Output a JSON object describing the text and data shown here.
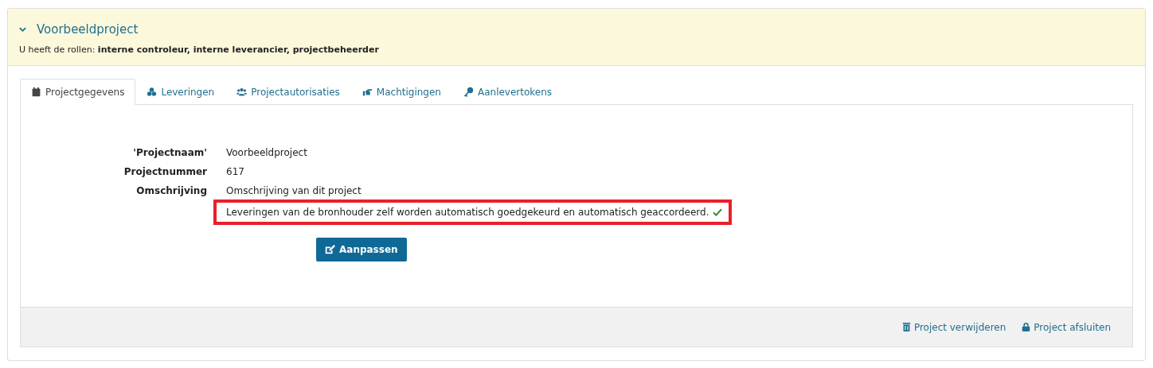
{
  "project": {
    "title": "Voorbeeldproject",
    "expanded": true,
    "roles_prefix": "U heeft de rollen: ",
    "roles": "interne controleur, interne leverancier, projectbeheerder"
  },
  "tabs": [
    {
      "label": "Projectgegevens",
      "kind": "calendar",
      "selected": true
    },
    {
      "label": "Leveringen",
      "kind": "cubes",
      "selected": false
    },
    {
      "label": "Projectautorisaties",
      "kind": "users",
      "selected": false
    },
    {
      "label": "Machtigingen",
      "kind": "hand",
      "selected": false
    },
    {
      "label": "Aanlevertokens",
      "kind": "key",
      "selected": false
    }
  ],
  "fields": [
    {
      "label": "'Projectnaam'",
      "value": "Voorbeeldproject"
    },
    {
      "label": "Projectnummer",
      "value": "617"
    },
    {
      "label": "Omschrijving",
      "value": "Omschrijving van dit project"
    }
  ],
  "note": {
    "text": "Leveringen van de bronhouder zelf worden automatisch goedgekeurd en automatisch geaccordeerd.",
    "checked": true,
    "highlighted": true
  },
  "edit_button": "Aanpassen",
  "footer_actions": [
    {
      "label": "Project verwijderen",
      "kind": "trash"
    },
    {
      "label": "Project afsluiten",
      "kind": "lock"
    }
  ]
}
